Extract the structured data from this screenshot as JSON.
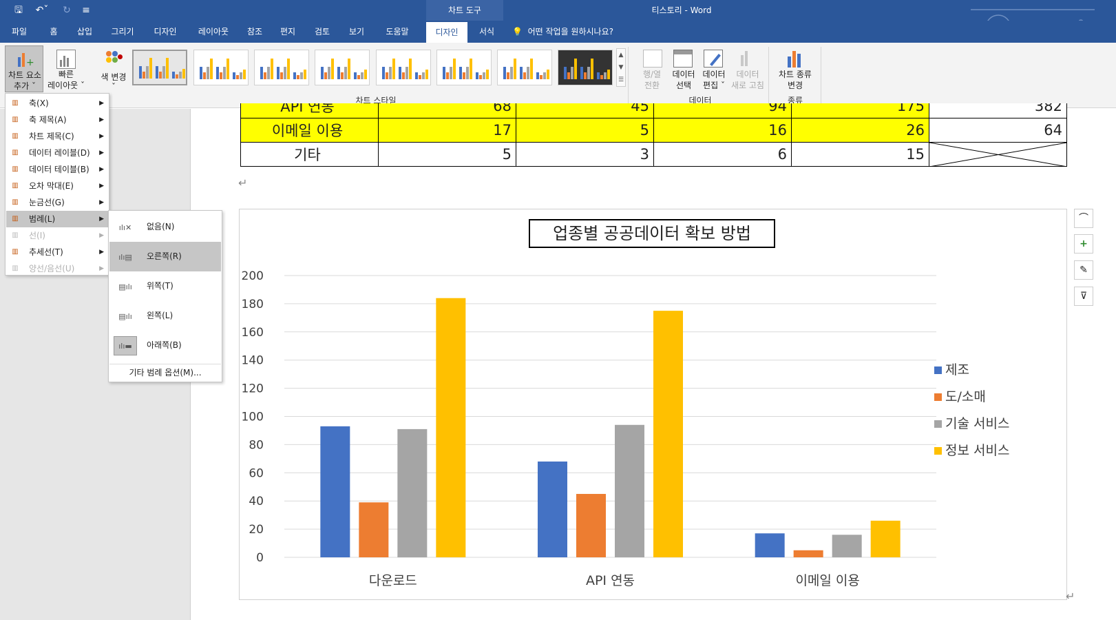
{
  "titlebar": {
    "quick_access": [
      "🖫",
      "↶",
      "⌄",
      "↻",
      "⌄"
    ],
    "context_group": "차트 도구",
    "doc_title": "티스토리  -  Word"
  },
  "tabs": [
    "파일",
    "홈",
    "삽입",
    "그리기",
    "디자인",
    "레이아웃",
    "참조",
    "편지",
    "검토",
    "보기",
    "도움말",
    "디자인",
    "서식"
  ],
  "active_tab_index": 11,
  "tell_me": "어떤 작업을 원하시나요?",
  "ribbon": {
    "add_element": [
      "차트 요소",
      "추가 ˇ"
    ],
    "quick_layout": [
      "빠른",
      "레이아웃 ˇ"
    ],
    "change_colors": [
      "색 변경",
      "ˇ"
    ],
    "chart_styles_label": "차트 스타일",
    "switch_row_col": [
      "행/열",
      "전환"
    ],
    "select_data": [
      "데이터",
      "선택"
    ],
    "edit_data": [
      "데이터",
      "편집 ˇ"
    ],
    "refresh_data": [
      "데이터",
      "새로 고침"
    ],
    "data_group_label": "데이터",
    "change_type": [
      "차트 종류",
      "변경"
    ],
    "type_group_label": "종류"
  },
  "menu": {
    "items": [
      {
        "label": "축(X)",
        "icon": "axes-icon",
        "disabled": false
      },
      {
        "label": "축 제목(A)",
        "icon": "axis-title-icon",
        "disabled": false
      },
      {
        "label": "차트 제목(C)",
        "icon": "chart-title-icon",
        "disabled": false
      },
      {
        "label": "데이터 레이블(D)",
        "icon": "data-labels-icon",
        "disabled": false
      },
      {
        "label": "데이터 테이블(B)",
        "icon": "data-table-icon",
        "disabled": false
      },
      {
        "label": "오차 막대(E)",
        "icon": "error-bars-icon",
        "disabled": false
      },
      {
        "label": "눈금선(G)",
        "icon": "gridlines-icon",
        "disabled": false
      },
      {
        "label": "범례(L)",
        "icon": "legend-icon",
        "disabled": false
      },
      {
        "label": "선(I)",
        "icon": "lines-icon",
        "disabled": true
      },
      {
        "label": "추세선(T)",
        "icon": "trendline-icon",
        "disabled": false
      },
      {
        "label": "양선/음선(U)",
        "icon": "up-down-bars-icon",
        "disabled": true
      }
    ],
    "highlighted_index": 7
  },
  "submenu": {
    "items": [
      "없음(N)",
      "오른쪽(R)",
      "위쪽(T)",
      "왼쪽(L)",
      "아래쪽(B)"
    ],
    "highlighted_index": 1,
    "more": "기타 범례 옵션(M)..."
  },
  "table": {
    "partial_row": [
      "API 연동",
      "68",
      "45",
      "94",
      "175",
      "382"
    ],
    "rows": [
      {
        "label": "이메일 이용",
        "values": [
          "17",
          "5",
          "16",
          "26",
          "64"
        ],
        "highlight": true
      },
      {
        "label": "기타",
        "values": [
          "5",
          "3",
          "6",
          "15",
          ""
        ],
        "highlight": false
      }
    ]
  },
  "chart_data": {
    "type": "bar",
    "title": "업종별 공공데이터 확보 방법",
    "categories": [
      "다운로드",
      "API 연동",
      "이메일 이용"
    ],
    "series": [
      {
        "name": "제조",
        "color": "#4472c4",
        "values": [
          93,
          68,
          17
        ]
      },
      {
        "name": "도/소매",
        "color": "#ed7d31",
        "values": [
          39,
          45,
          5
        ]
      },
      {
        "name": "기술 서비스",
        "color": "#a5a5a5",
        "values": [
          91,
          94,
          16
        ]
      },
      {
        "name": "정보 서비스",
        "color": "#ffc000",
        "values": [
          184,
          175,
          26
        ]
      }
    ],
    "ylim": [
      0,
      200
    ],
    "yticks": [
      0,
      20,
      40,
      60,
      80,
      100,
      120,
      140,
      160,
      180,
      200
    ],
    "grid": true,
    "legend": "right"
  },
  "chart_side_buttons": [
    "layout-options-icon",
    "chart-elements-icon",
    "chart-styles-icon",
    "chart-filters-icon"
  ]
}
